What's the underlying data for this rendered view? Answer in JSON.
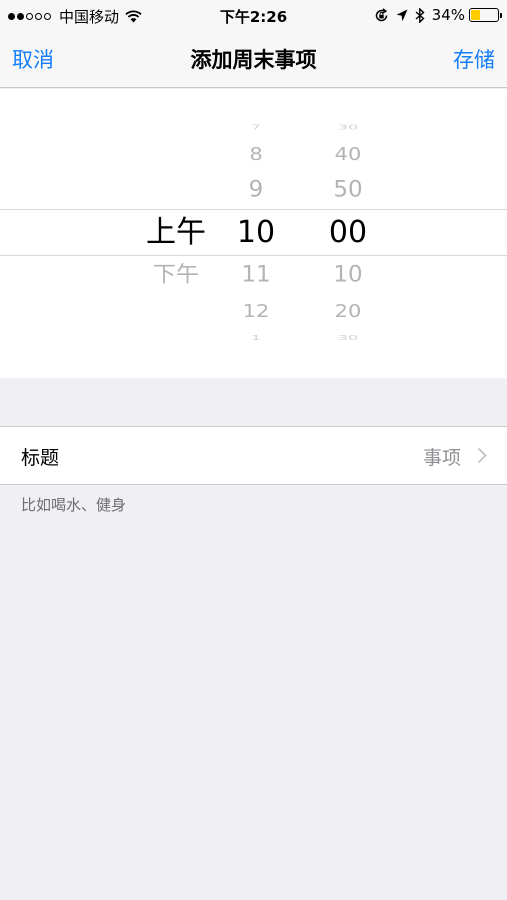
{
  "status_bar": {
    "carrier": "中国移动",
    "time": "下午2:26",
    "battery_percent": "34%",
    "battery_level": 0.34,
    "battery_color": "#ffcc00",
    "signal_bars_filled": 2,
    "signal_bars_total": 5
  },
  "nav": {
    "cancel_label": "取消",
    "title": "添加周末事项",
    "save_label": "存储",
    "accent_color": "#147efb"
  },
  "picker": {
    "ampm": [
      "上午",
      "下午"
    ],
    "hours": [
      "7",
      "8",
      "9",
      "10",
      "11",
      "12",
      "1"
    ],
    "minutes": [
      "30",
      "40",
      "50",
      "00",
      "10",
      "20",
      "30"
    ],
    "selected": {
      "ampm": "上午",
      "hour": "10",
      "minute": "00"
    }
  },
  "form": {
    "title_label": "标题",
    "title_value": "事项",
    "hint": "比如喝水、健身"
  }
}
